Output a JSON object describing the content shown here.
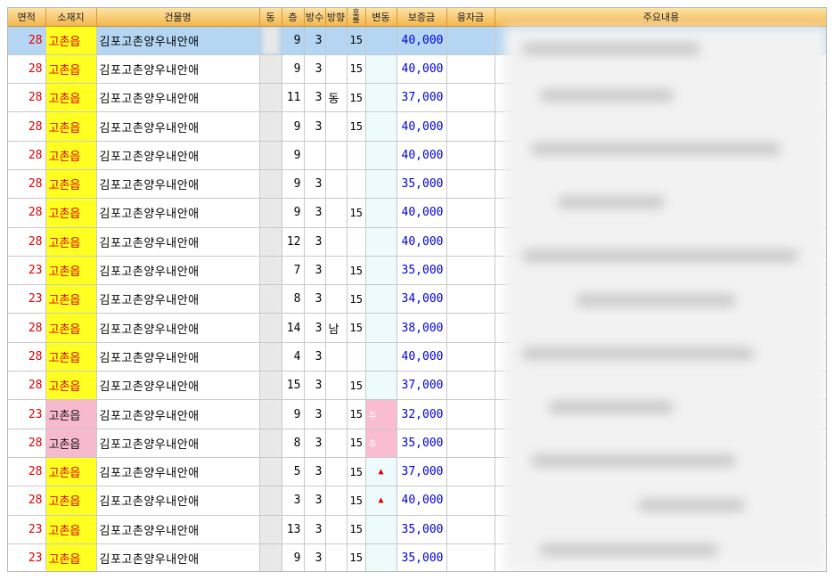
{
  "header": {
    "area": "면적",
    "location": "소재지",
    "building": "건물명",
    "dong": "동",
    "floor": "층",
    "rooms": "방수",
    "direction": "방향",
    "type": "호\n률",
    "change": "변동",
    "deposit": "보증금",
    "loan": "융자금",
    "notes": "주요내용"
  },
  "rows": [
    {
      "area": "28",
      "location": "고촌읍",
      "building": "김포고촌양우내안애",
      "floor": "9",
      "rooms": "3",
      "direction": "",
      "type": "15",
      "change": "",
      "deposit": "40,000",
      "loc_pink": false,
      "chg_pink": false
    },
    {
      "area": "28",
      "location": "고촌읍",
      "building": "김포고촌양우내안애",
      "floor": "9",
      "rooms": "3",
      "direction": "",
      "type": "15",
      "change": "",
      "deposit": "40,000",
      "loc_pink": false,
      "chg_pink": false
    },
    {
      "area": "28",
      "location": "고촌읍",
      "building": "김포고촌양우내안애",
      "floor": "11",
      "rooms": "3",
      "direction": "동",
      "type": "15",
      "change": "",
      "deposit": "37,000",
      "loc_pink": false,
      "chg_pink": false
    },
    {
      "area": "28",
      "location": "고촌읍",
      "building": "김포고촌양우내안애",
      "floor": "9",
      "rooms": "3",
      "direction": "",
      "type": "15",
      "change": "",
      "deposit": "40,000",
      "loc_pink": false,
      "chg_pink": false
    },
    {
      "area": "28",
      "location": "고촌읍",
      "building": "김포고촌양우내안애",
      "floor": "9",
      "rooms": "",
      "direction": "",
      "type": "",
      "change": "",
      "deposit": "40,000",
      "loc_pink": false,
      "chg_pink": false
    },
    {
      "area": "28",
      "location": "고촌읍",
      "building": "김포고촌양우내안애",
      "floor": "9",
      "rooms": "3",
      "direction": "",
      "type": "",
      "change": "",
      "deposit": "35,000",
      "loc_pink": false,
      "chg_pink": false
    },
    {
      "area": "28",
      "location": "고촌읍",
      "building": "김포고촌양우내안애",
      "floor": "9",
      "rooms": "3",
      "direction": "",
      "type": "15",
      "change": "",
      "deposit": "40,000",
      "loc_pink": false,
      "chg_pink": false
    },
    {
      "area": "28",
      "location": "고촌읍",
      "building": "김포고촌양우내안애",
      "floor": "12",
      "rooms": "3",
      "direction": "",
      "type": "",
      "change": "",
      "deposit": "40,000",
      "loc_pink": false,
      "chg_pink": false
    },
    {
      "area": "23",
      "location": "고촌읍",
      "building": "김포고촌양우내안애",
      "floor": "7",
      "rooms": "3",
      "direction": "",
      "type": "15",
      "change": "",
      "deposit": "35,000",
      "loc_pink": false,
      "chg_pink": false
    },
    {
      "area": "23",
      "location": "고촌읍",
      "building": "김포고촌양우내안애",
      "floor": "8",
      "rooms": "3",
      "direction": "",
      "type": "15",
      "change": "",
      "deposit": "34,000",
      "loc_pink": false,
      "chg_pink": false
    },
    {
      "area": "28",
      "location": "고촌읍",
      "building": "김포고촌양우내안애",
      "floor": "14",
      "rooms": "3",
      "direction": "남",
      "type": "15",
      "change": "",
      "deposit": "38,000",
      "loc_pink": false,
      "chg_pink": false
    },
    {
      "area": "28",
      "location": "고촌읍",
      "building": "김포고촌양우내안애",
      "floor": "4",
      "rooms": "3",
      "direction": "",
      "type": "",
      "change": "",
      "deposit": "40,000",
      "loc_pink": false,
      "chg_pink": false
    },
    {
      "area": "28",
      "location": "고촌읍",
      "building": "김포고촌양우내안애",
      "floor": "15",
      "rooms": "3",
      "direction": "",
      "type": "15",
      "change": "",
      "deposit": "37,000",
      "loc_pink": false,
      "chg_pink": false
    },
    {
      "area": "23",
      "location": "고촌읍",
      "building": "김포고촌양우내안애",
      "floor": "9",
      "rooms": "3",
      "direction": "",
      "type": "15",
      "change": "추",
      "deposit": "32,000",
      "loc_pink": true,
      "chg_pink": true
    },
    {
      "area": "28",
      "location": "고촌읍",
      "building": "김포고촌양우내안애",
      "floor": "8",
      "rooms": "3",
      "direction": "",
      "type": "15",
      "change": "추",
      "deposit": "35,000",
      "loc_pink": true,
      "chg_pink": true
    },
    {
      "area": "28",
      "location": "고촌읍",
      "building": "김포고촌양우내안애",
      "floor": "5",
      "rooms": "3",
      "direction": "",
      "type": "15",
      "change": "▲",
      "deposit": "37,000",
      "loc_pink": false,
      "chg_pink": false
    },
    {
      "area": "28",
      "location": "고촌읍",
      "building": "김포고촌양우내안애",
      "floor": "3",
      "rooms": "3",
      "direction": "",
      "type": "15",
      "change": "▲",
      "deposit": "40,000",
      "loc_pink": false,
      "chg_pink": false
    },
    {
      "area": "23",
      "location": "고촌읍",
      "building": "김포고촌양우내안애",
      "floor": "13",
      "rooms": "3",
      "direction": "",
      "type": "15",
      "change": "",
      "deposit": "35,000",
      "loc_pink": false,
      "chg_pink": false
    },
    {
      "area": "23",
      "location": "고촌읍",
      "building": "김포고촌양우내안애",
      "floor": "9",
      "rooms": "3",
      "direction": "",
      "type": "15",
      "change": "",
      "deposit": "35,000",
      "loc_pink": false,
      "chg_pink": false
    }
  ],
  "colors": {
    "header_top": "#fde3a6",
    "header_bottom": "#f3b64e",
    "location_bg": "#ffff22",
    "pink_bg": "#f7b9cd",
    "selected_row": "#b4d6f3",
    "deposit_text": "#0000dd",
    "area_text": "#e00000"
  }
}
